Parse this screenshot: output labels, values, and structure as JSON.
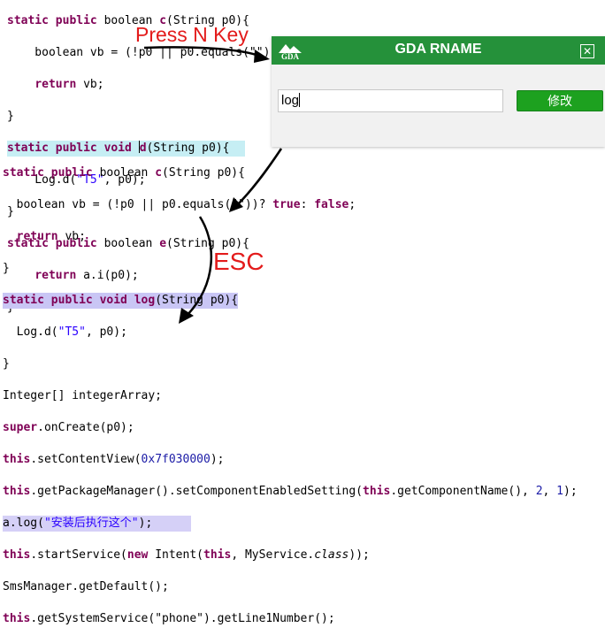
{
  "code_top": {
    "line1": {
      "kw": "static public",
      "rest1": " boolean ",
      "name": "c",
      "rest2": "(String p0){"
    },
    "line2": {
      "pre": "    boolean vb = (!p0 || p0.equals(\"\"))? ",
      "kw_true": "true",
      "mid": ": ",
      "kw_false": "false",
      "end": ";"
    },
    "line3": {
      "kw": "return",
      "rest": " vb;"
    },
    "line4": "}",
    "line5": {
      "kw": "static public void",
      "pre": " ",
      "caret_char": "d",
      "rest": "(String p0){"
    },
    "line6": {
      "pre": "    Log.d(",
      "str": "\"T5\"",
      "rest": ", p0);"
    },
    "line7": "}",
    "line8": {
      "kw": "static public",
      "rest1": " boolean ",
      "name": "e",
      "rest2": "(String p0){"
    },
    "line9": {
      "kw": "return",
      "rest": " a.i(p0);"
    },
    "line10": "}"
  },
  "code_bottom": {
    "line1": {
      "kw": "static public",
      "rest1": " boolean ",
      "name": "c",
      "rest2": "(String p0){"
    },
    "line2": {
      "pre": "  boolean vb = (!p0 || p0.equals(\"\"))",
      "mid": "? ",
      "kw_true": "true",
      "mid2": ": ",
      "kw_false": "false",
      "end": ";"
    },
    "line3": {
      "kw": "return",
      "rest": " vb;"
    },
    "line4": "}",
    "line5": {
      "kw": "static public void",
      "name": " log",
      "rest": "(String p0){"
    },
    "line6": {
      "pre": "  Log.d(",
      "str": "\"T5\"",
      "rest": ", p0);"
    },
    "line7": "}",
    "line8": "Integer[] integerArray;",
    "line9": {
      "kw": "super",
      "rest": ".onCreate(p0);"
    },
    "line10": {
      "kw": "this",
      "pre": ".setContentView(",
      "num": "0x7f030000",
      "rest": ");"
    },
    "line11": {
      "kw": "this",
      "pre": ".getPackageManager().setComponentEnabledSetting(",
      "kw2": "this",
      "mid": ".getComponentName(), ",
      "n1": "2",
      "sep": ", ",
      "n2": "1",
      "end": ");"
    },
    "line12": {
      "pre": "a.log(",
      "str": "\"安装后执行这个\"",
      "rest": ");"
    },
    "line13": {
      "kw": "this",
      "pre": ".startService(",
      "kw2": "new",
      "mid": " Intent(",
      "kw3": "this",
      "mid2": ", MyService.",
      "it": "class",
      "end": "));"
    },
    "line14": "SmsManager.getDefault();",
    "line15": {
      "kw": "this",
      "rest": ".getSystemService(\"phone\").getLine1Number();"
    }
  },
  "dialog": {
    "title": "GDA RNAME",
    "logo_text": "GDA",
    "close_label": "✕",
    "input_value": "log",
    "button_label": "修改"
  },
  "annotations": {
    "press_n_key": "Press N Key",
    "esc": "ESC"
  },
  "colors": {
    "dialog_title_bg": "#25913a",
    "button_bg": "#1da11f",
    "annotation_red": "#e31b1b",
    "keyword": "#7f0055",
    "string": "#2a00ff",
    "highlight_top": "#c6eef4",
    "highlight_bottom": "#c9c6f5"
  }
}
